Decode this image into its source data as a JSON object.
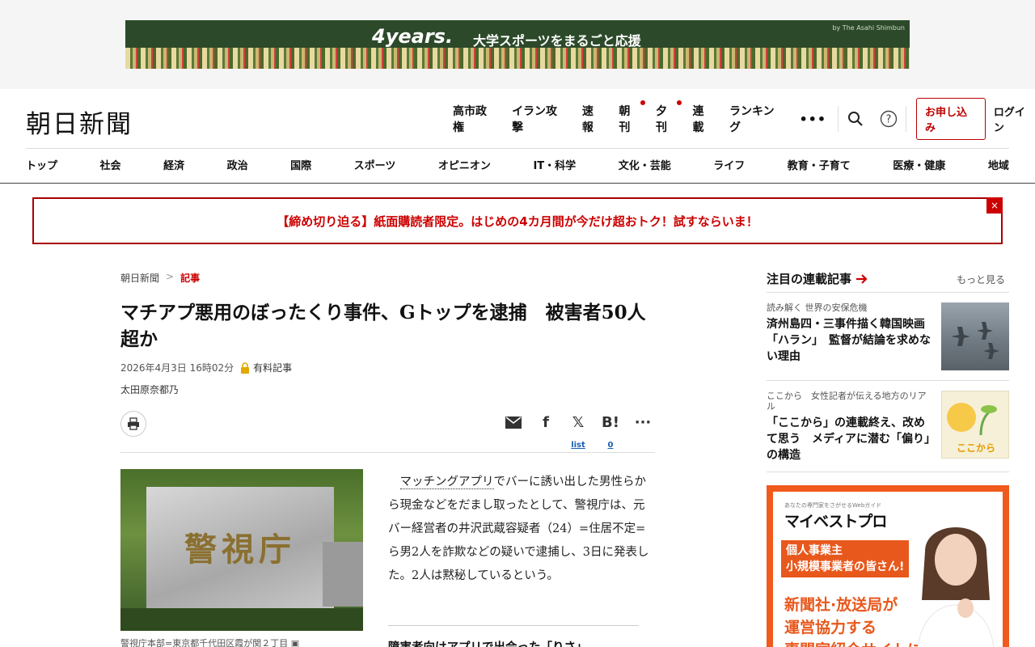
{
  "top_ad": {
    "logo": "4years.",
    "tagline": "大学スポーツをまるごと応援",
    "by": "by The Asahi Shimbun"
  },
  "header": {
    "logo": "朝日新聞",
    "utility": [
      "高市政権",
      "イラン攻撃",
      "速報",
      "朝刊",
      "夕刊",
      "連載",
      "ランキング"
    ],
    "more": "•••",
    "subscribe": "お申し込み",
    "login": "ログイン"
  },
  "categories": [
    "トップ",
    "社会",
    "経済",
    "政治",
    "国際",
    "スポーツ",
    "オピニオン",
    "IT・科学",
    "文化・芸能",
    "ライフ",
    "教育・子育て",
    "医療・健康",
    "地域"
  ],
  "promo": {
    "text": "【締め切り迫る】紙面購読者限定。はじめの4カ月間が今だけ超おトク！試すならいま！",
    "close": "×"
  },
  "article": {
    "breadcrumb": [
      "朝日新聞",
      "記事"
    ],
    "breadcrumb_sep": ">",
    "headline": "マチアプ悪用のぼったくり事件、Gトップを逮捕　被害者50人超か",
    "date": "2026年4月3日 16時02分",
    "paid_label": "有料記事",
    "author": "太田原奈都乃",
    "share_counts": {
      "x": "list",
      "hatena": "0"
    },
    "photo_text": "警視庁",
    "caption": "警視庁本部=東京都千代田区霞が関２丁目",
    "body_link": "マッチングアプリ",
    "body_rest": "でバーに誘い出した男性らから現金などをだまし取ったとして、警視庁は、元バー経営者の井沢武蔵容疑者（24）=住居不定=ら男2人を詐欺などの疑いで逮捕し、3日に発表した。2人は黙秘しているという。",
    "related": "障害者向けアプリで出会った「りさ」"
  },
  "sidebar": {
    "title": "注目の連載記事",
    "more": "もっと見る",
    "items": [
      {
        "kicker": "読み解く 世界の安保危機",
        "title": "済州島四・三事件描く韓国映画「ハラン」　監督が結論を求めない理由"
      },
      {
        "kicker": "ここから　女性記者が伝える地方のリアル",
        "title": "「ここから」の連載終え、改めて思う　メディアに潜む「偏り」の構造"
      }
    ],
    "koko_label": "ここから",
    "ad": {
      "sub": "あなたの専門家をさがせるWebガイド",
      "brand": "マイベストプロ",
      "box_line1": "個人事業主",
      "box_line2": "小規模事業者の皆さん!",
      "big_line1": "新聞社·放送局が",
      "big_line2": "運営協力する",
      "big_line3": "専門家紹介サイトに"
    }
  },
  "colors": {
    "accent": "#c00000",
    "ad_orange": "#f05a1c"
  }
}
